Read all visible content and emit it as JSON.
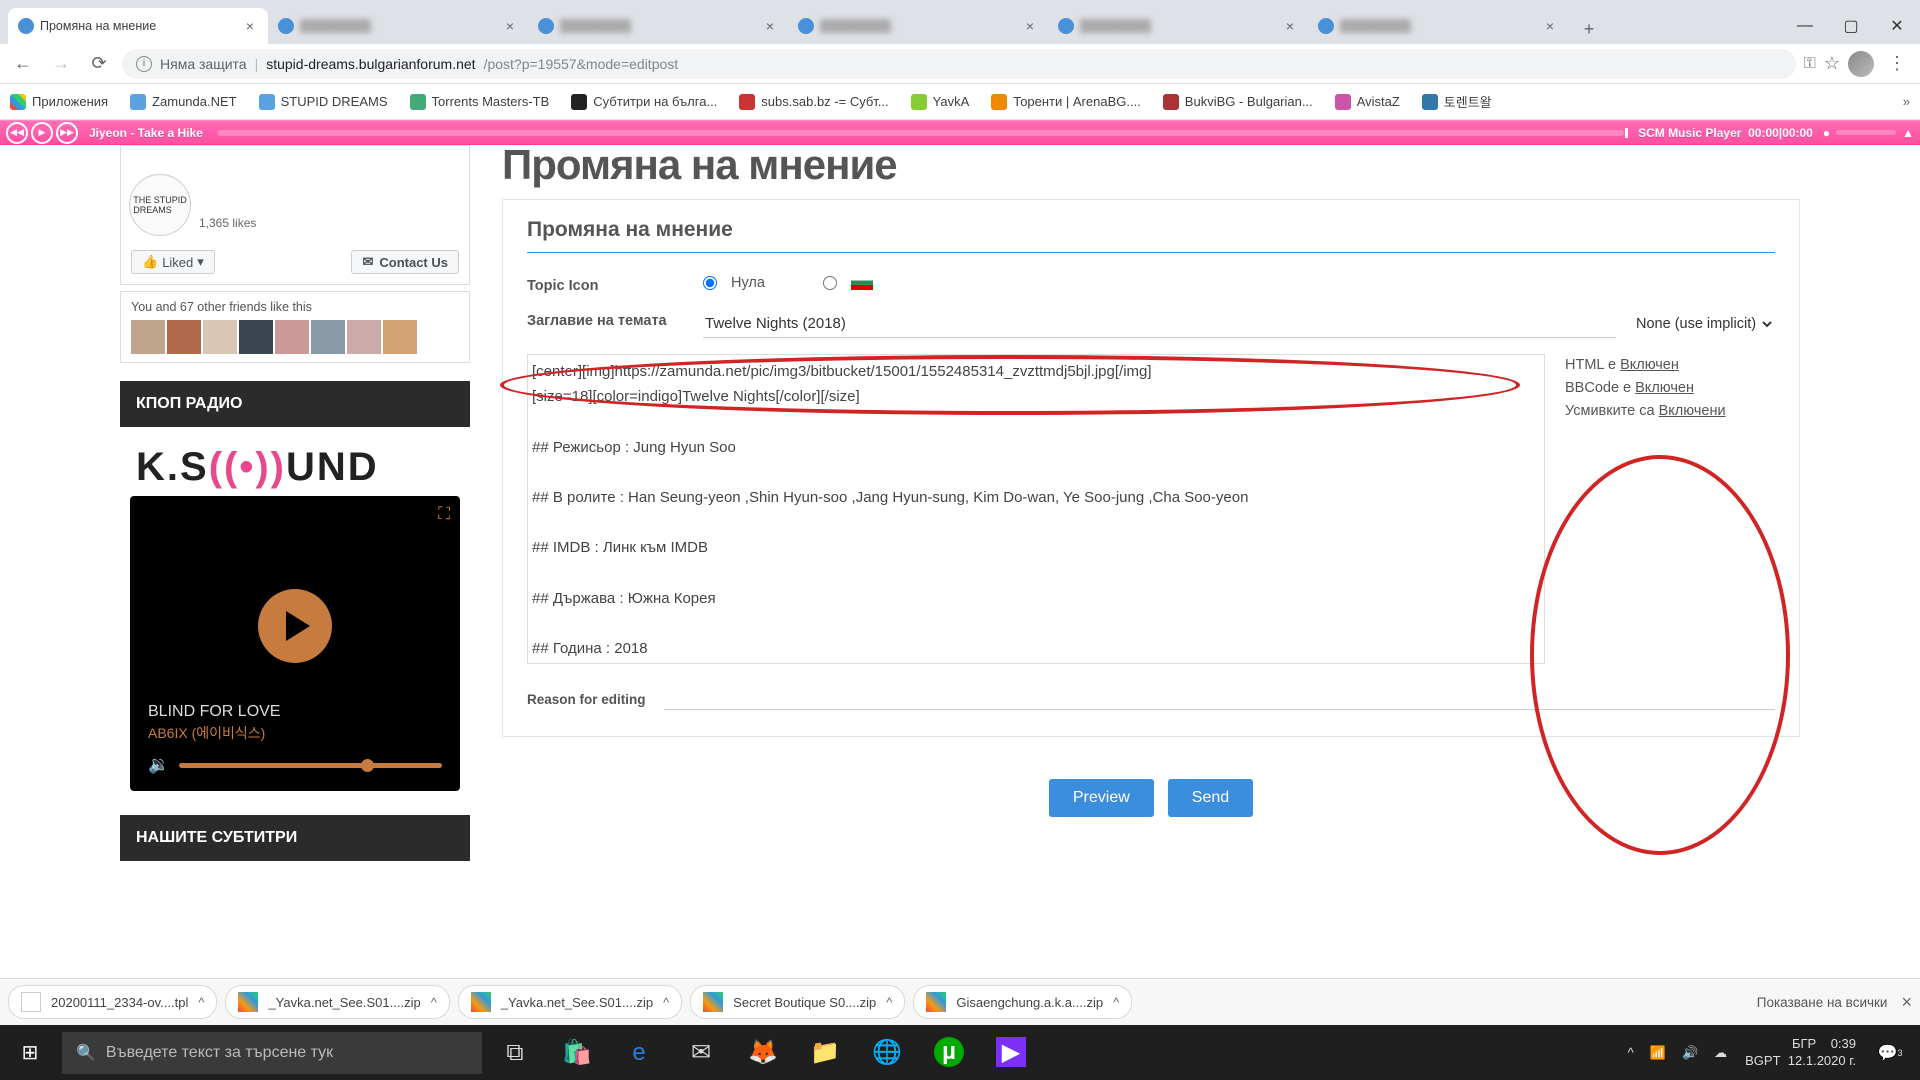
{
  "browser": {
    "tabs": [
      {
        "title": "Промяна на мнение",
        "active": true
      },
      {
        "title": "",
        "active": false
      },
      {
        "title": "",
        "active": false
      },
      {
        "title": "",
        "active": false
      },
      {
        "title": "",
        "active": false
      },
      {
        "title": "",
        "active": false
      }
    ],
    "security": "Няма защита",
    "url_host": "stupid-dreams.bulgarianforum.net",
    "url_path": "/post?p=19557&mode=editpost",
    "bookmarks": [
      "Приложения",
      "Zamunda.NET",
      "STUPID DREAMS",
      "Torrents Masters-TB",
      "Субтитри на бълга...",
      "subs.sab.bz -= Субт...",
      "YavkA",
      "Торенти | ArenaBG....",
      "BukviBG - Bulgarian...",
      "AvistaZ",
      "토렌트왈"
    ]
  },
  "music_bar": {
    "track": "Jiyeon - Take a Hike",
    "brand": "SCM Music Player",
    "time": "00:00|00:00"
  },
  "sidebar": {
    "fb": {
      "likes": "1,365 likes",
      "liked": "Liked",
      "contact": "Contact Us",
      "friends": "You and 67 other friends like this"
    },
    "radio_h": "КПОП РАДИО",
    "ksound": {
      "a": "K.S",
      "b": "((•))",
      "c": "UND"
    },
    "player": {
      "title": "BLIND FOR LOVE",
      "artist": "AB6IX (에이비식스)"
    },
    "subs_h": "НАШИТЕ СУБТИТРИ"
  },
  "form": {
    "h1": "Промяна на мнение",
    "h2": "Промяна на мнение",
    "topic_icon_label": "Topic Icon",
    "topic_icon_opt": "Нула",
    "title_label": "Заглавие на темата",
    "title_value": "Twelve Nights (2018)",
    "select_value": "None (use implicit)",
    "body": "[center][img]https://zamunda.net/pic/img3/bitbucket/15001/1552485314_zvzttmdj5bjl.jpg[/img]\n[size=18][color=indigo]Twelve Nights[/color][/size]\n\n## Режисьор : Jung Hyun Soo\n\n## В ролите : Han Seung-yeon ,Shin Hyun-soo ,Jang Hyun-sung, Kim Do-wan, Ye Soo-jung ,Cha Soo-yeon\n\n## IMDB : Линк към IMDB\n\n## Държава : Южна Корея\n\n## Година : 2018",
    "info": {
      "html_pre": "HTML е ",
      "html_link": "Включен",
      "bb_pre": "BBCode е ",
      "bb_link": "Включен",
      "sm_pre": "Усмивките са ",
      "sm_link": "Включени"
    },
    "reason_label": "Reason for editing",
    "preview": "Preview",
    "send": "Send"
  },
  "downloads": {
    "items": [
      {
        "name": "20200111_2334-ov....tpl",
        "zip": false
      },
      {
        "name": "_Yavka.net_See.S01....zip",
        "zip": true
      },
      {
        "name": "_Yavka.net_See.S01....zip",
        "zip": true
      },
      {
        "name": "Secret Boutique S0....zip",
        "zip": true
      },
      {
        "name": "Gisaengchung.a.k.a....zip",
        "zip": true
      }
    ],
    "show_all": "Показване на всички"
  },
  "taskbar": {
    "search_placeholder": "Въведете текст за търсене тук",
    "lang": "БГР",
    "ime": "BGPT",
    "time": "0:39",
    "date": "12.1.2020 г.",
    "notif": "3"
  }
}
